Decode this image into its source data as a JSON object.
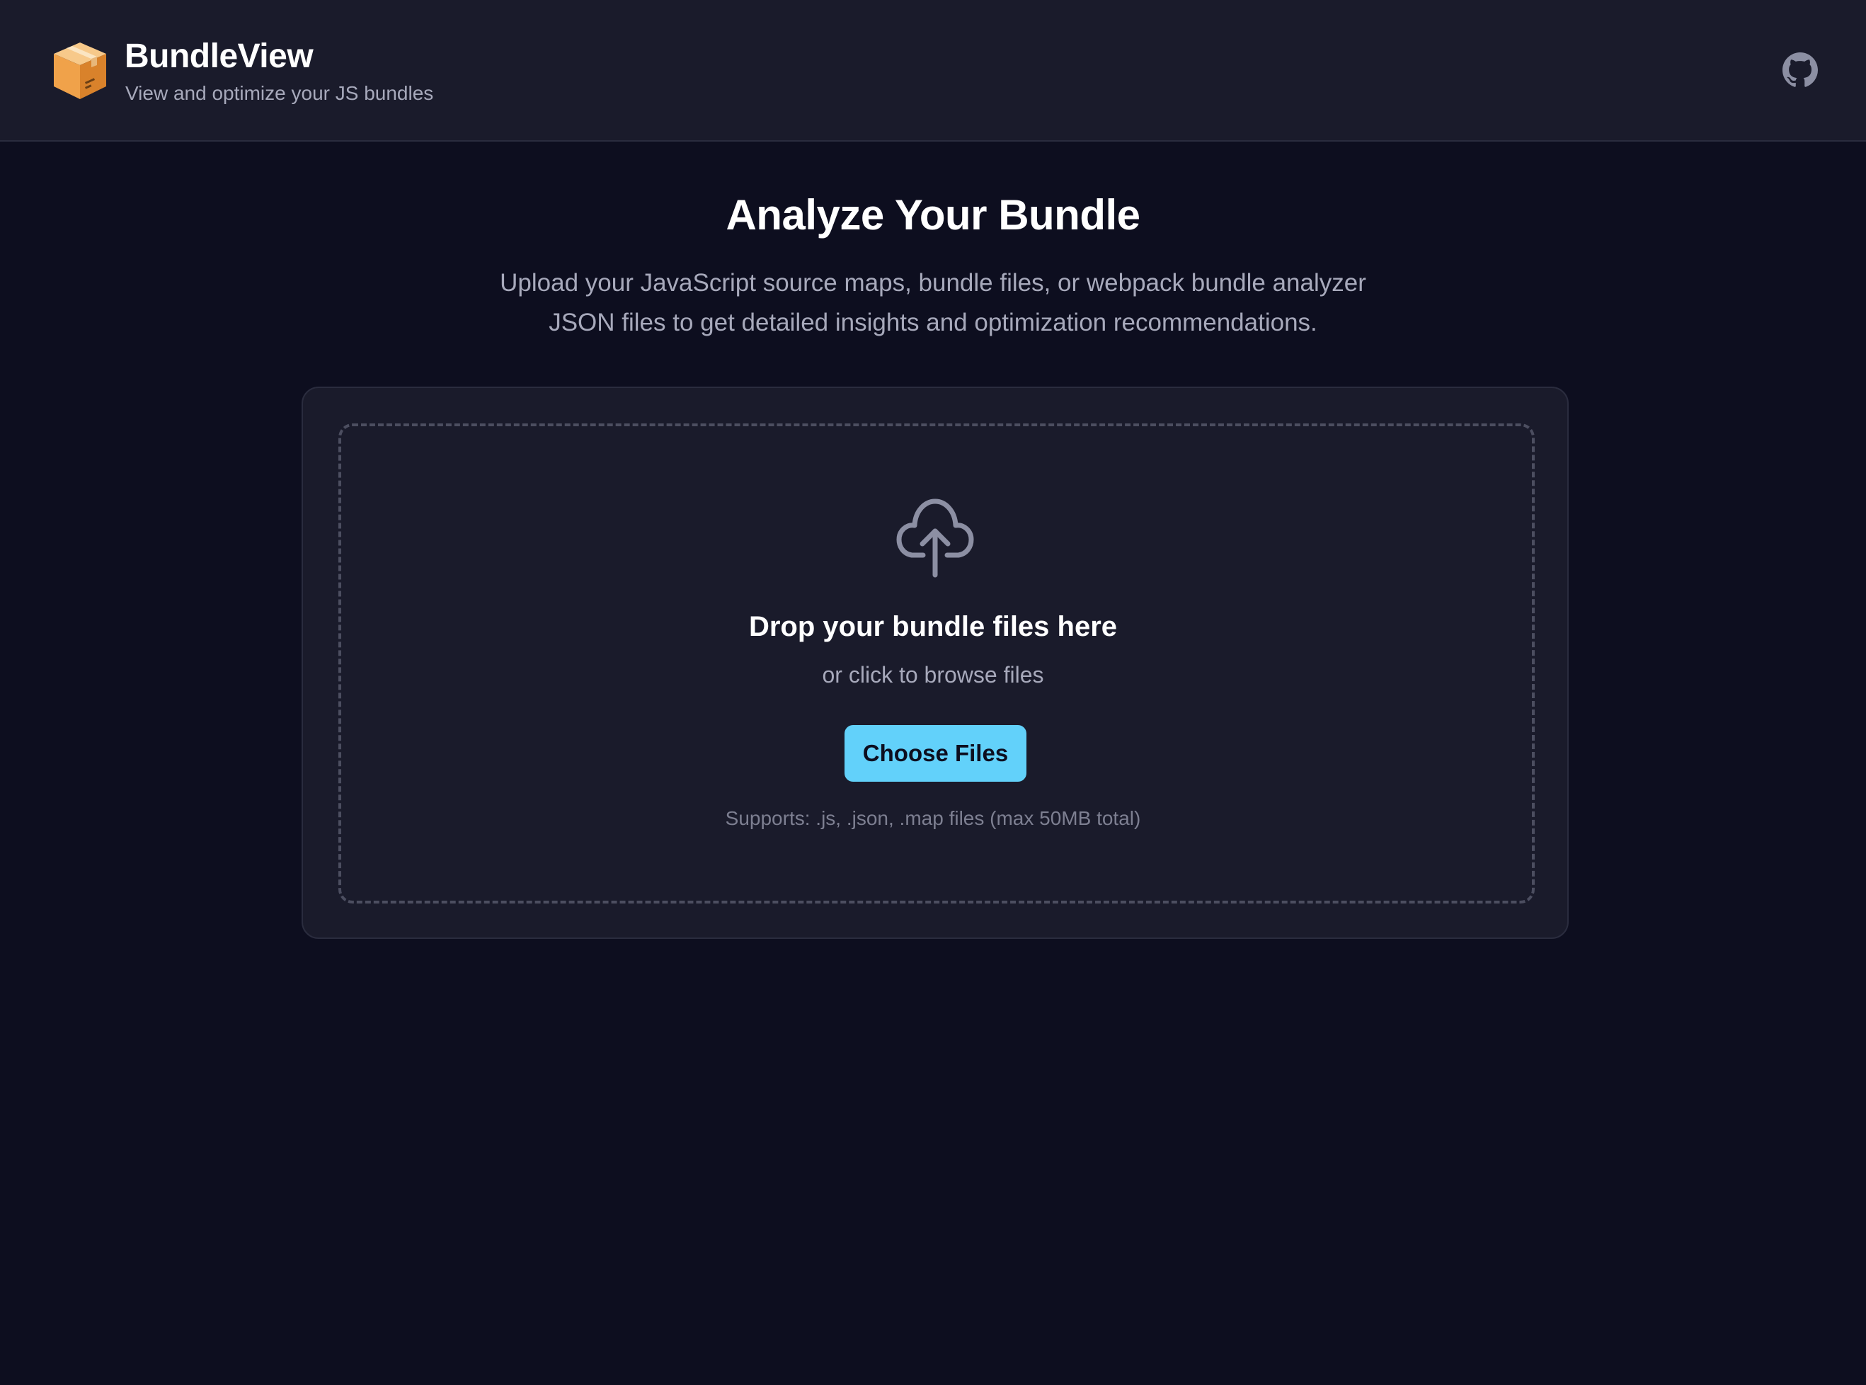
{
  "header": {
    "app_title": "BundleView",
    "app_subtitle": "View and optimize your JS bundles",
    "logo_icon": "package-box-icon",
    "github_icon": "github-icon"
  },
  "main": {
    "title": "Analyze Your Bundle",
    "description": "Upload your JavaScript source maps, bundle files, or webpack bundle analyzer JSON files to get detailed insights and optimization recommendations."
  },
  "dropzone": {
    "icon": "cloud-upload-icon",
    "title": "Drop your bundle files here",
    "subtitle": "or click to browse files",
    "button_label": "Choose Files",
    "supports_note": "Supports: .js, .json, .map files (max 50MB total)"
  },
  "colors": {
    "page_background": "#0d0e1f",
    "surface": "#1a1b2b",
    "accent": "#62d1fa",
    "text_muted": "#a7a9bb",
    "logo_box": "#f0a24a"
  }
}
